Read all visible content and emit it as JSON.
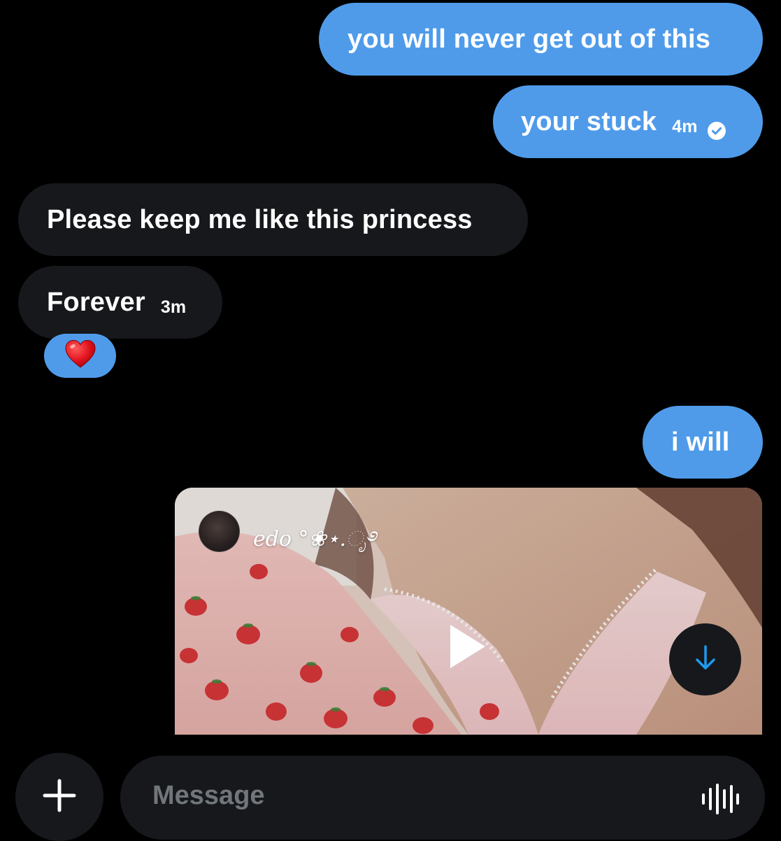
{
  "messages": [
    {
      "direction": "sent",
      "text": "you will never get out of this"
    },
    {
      "direction": "sent",
      "text": "your stuck",
      "time": "4m",
      "status": "read"
    },
    {
      "direction": "received",
      "text": "Please keep me like this princess"
    },
    {
      "direction": "received",
      "text": "Forever",
      "time": "3m",
      "reaction": "❤️"
    },
    {
      "direction": "sent",
      "text": "i will"
    }
  ],
  "media": {
    "author_name": "edo °❀⋆.ೃ࿔",
    "type": "video"
  },
  "composer": {
    "placeholder": "Message"
  },
  "icons": {
    "read_receipt": "check-circle-icon",
    "play": "play-icon",
    "download": "arrow-down-icon",
    "add": "plus-icon",
    "voice": "waveform-icon"
  },
  "colors": {
    "background": "#000000",
    "sent_bubble": "#4f9bea",
    "received_bubble": "#16181c",
    "placeholder_text": "#71767b",
    "accent": "#1d9bf0"
  }
}
